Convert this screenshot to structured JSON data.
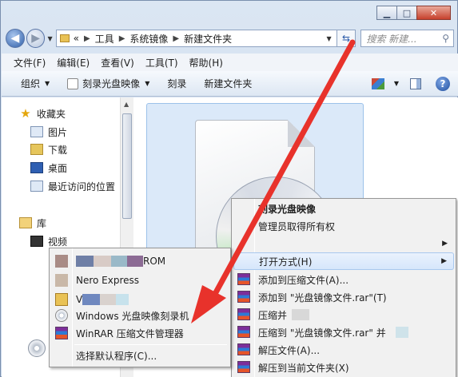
{
  "window": {
    "caption": {
      "minimize": "▁",
      "maximize": "□",
      "close": "✕"
    }
  },
  "address": {
    "prefix": "«",
    "breadcrumbs": [
      "工具",
      "系统镜像",
      "新建文件夹"
    ],
    "search_placeholder": "搜索 新建..."
  },
  "menubar": [
    "文件(F)",
    "编辑(E)",
    "查看(V)",
    "工具(T)",
    "帮助(H)"
  ],
  "commandbar": {
    "organize": "组织",
    "burn_image": "刻录光盘映像",
    "burn": "刻录",
    "new_folder": "新建文件夹"
  },
  "navpane": {
    "favorites": "收藏夹",
    "fav_items": [
      "图片",
      "下载",
      "桌面",
      "最近访问的位置"
    ],
    "libraries": "库",
    "lib_items": [
      "视频"
    ]
  },
  "context_menu": {
    "items": [
      "刻录光盘映像",
      "管理员取得所有权",
      "打开方式(H)",
      "添加到压缩文件(A)...",
      "添加到 \"光盘镜像文件.rar\"(T)",
      "压缩并",
      "压缩到 \"光盘镜像文件.rar\" 并",
      "解压文件(A)...",
      "解压到当前文件夹(X)"
    ]
  },
  "open_with_menu": {
    "items": [
      "ROM",
      "Nero Express",
      "V",
      "Windows 光盘映像刻录机",
      "WinRAR 压缩文件管理器",
      "选择默认程序(C)..."
    ]
  },
  "colors": {
    "arrow": "#e8322b",
    "highlight": "#d6e6fb",
    "selection": "#dbe9f9"
  }
}
